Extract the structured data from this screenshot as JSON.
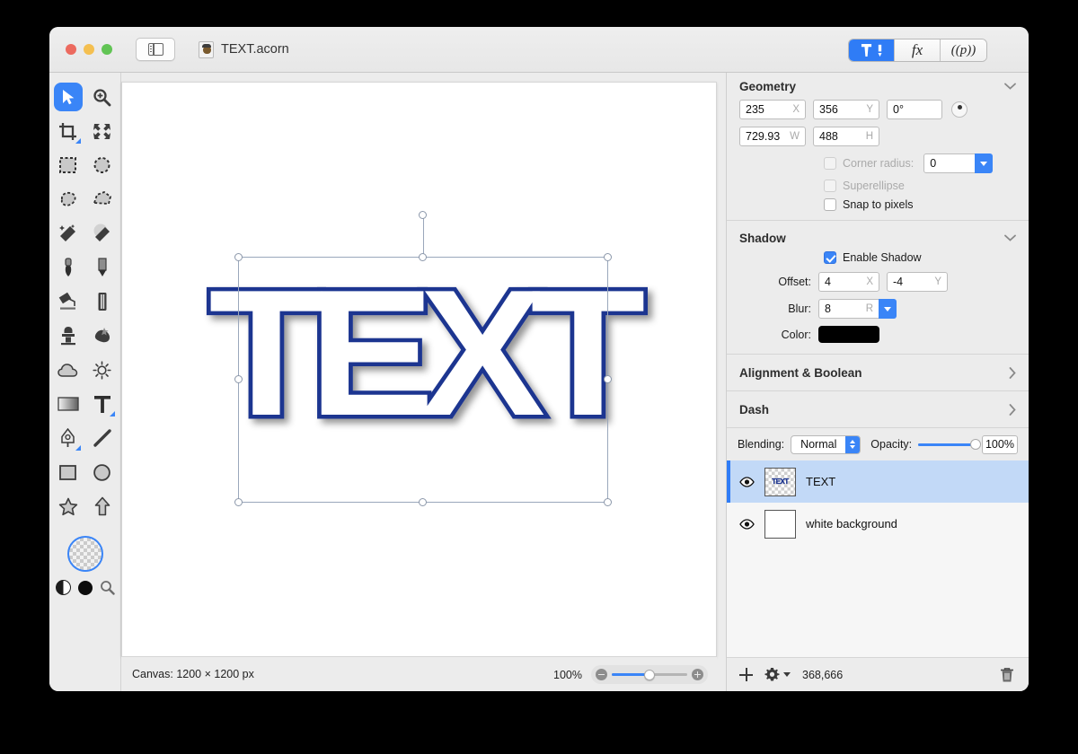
{
  "window": {
    "traffic_lights": [
      "close",
      "minimize",
      "zoom"
    ],
    "sidebar_toggle_icon": "sidebar-toggle-icon",
    "document_title": "TEXT.acorn",
    "document_icon": "acorn-document-icon"
  },
  "toolbar": {
    "segments": [
      {
        "id": "tools",
        "icon": "hammer-pen-icon",
        "label": "",
        "active": true
      },
      {
        "id": "effects",
        "label": "fx",
        "active": false
      },
      {
        "id": "presets",
        "label": "((p))",
        "active": false
      }
    ]
  },
  "tools": {
    "items": [
      {
        "name": "move-select-tool",
        "icon": "arrow-cursor-icon",
        "selected": true
      },
      {
        "name": "zoom-tool",
        "icon": "magnifier-plus-icon",
        "selected": false
      },
      {
        "name": "crop-tool",
        "icon": "crop-icon",
        "selected": false,
        "has_options": true
      },
      {
        "name": "transform-tool",
        "icon": "four-arrows-icon",
        "selected": false
      },
      {
        "name": "rectangle-select-tool",
        "icon": "dashed-rectangle-icon",
        "selected": false
      },
      {
        "name": "ellipse-select-tool",
        "icon": "dashed-circle-icon",
        "selected": false
      },
      {
        "name": "lasso-tool",
        "icon": "dashed-lasso-icon",
        "selected": false
      },
      {
        "name": "polygon-lasso-tool",
        "icon": "dashed-polygon-icon",
        "selected": false
      },
      {
        "name": "magic-wand-tool",
        "icon": "magic-wand-icon",
        "selected": false
      },
      {
        "name": "instant-alpha-tool",
        "icon": "dotted-wand-icon",
        "selected": false
      },
      {
        "name": "brush-tool",
        "icon": "brush-icon",
        "selected": false
      },
      {
        "name": "pencil-tool",
        "icon": "pencil-icon",
        "selected": false
      },
      {
        "name": "paint-bucket-tool",
        "icon": "paint-bucket-icon",
        "selected": false
      },
      {
        "name": "eraser-tool",
        "icon": "eraser-icon",
        "selected": false
      },
      {
        "name": "clone-stamp-tool",
        "icon": "clone-stamp-icon",
        "selected": false
      },
      {
        "name": "smudge-tool",
        "icon": "smudge-splat-icon",
        "selected": false
      },
      {
        "name": "blur-tool",
        "icon": "cloud-icon",
        "selected": false
      },
      {
        "name": "dodge-tool",
        "icon": "sun-icon",
        "selected": false
      },
      {
        "name": "gradient-tool",
        "icon": "gradient-icon",
        "selected": false
      },
      {
        "name": "text-tool",
        "icon": "text-t-icon",
        "selected": false,
        "has_options": true
      },
      {
        "name": "bezier-pen-tool",
        "icon": "pen-nib-icon",
        "selected": false,
        "has_options": true
      },
      {
        "name": "line-tool",
        "icon": "line-icon",
        "selected": false
      },
      {
        "name": "rectangle-shape-tool",
        "icon": "rectangle-icon",
        "selected": false
      },
      {
        "name": "ellipse-shape-tool",
        "icon": "circle-icon",
        "selected": false
      },
      {
        "name": "star-shape-tool",
        "icon": "star-icon",
        "selected": false
      },
      {
        "name": "arrow-shape-tool",
        "icon": "arrow-up-icon",
        "selected": false
      }
    ],
    "color_well": {
      "name": "color-well",
      "icon": "transparent-checker-icon"
    },
    "mini_controls": [
      {
        "name": "swap-colors-swatch",
        "icon": "half-black-half-white-circle-icon"
      },
      {
        "name": "foreground-color-swatch",
        "icon": "black-circle-icon",
        "color": "#000000"
      },
      {
        "name": "eyedropper-tool",
        "icon": "magnifier-icon"
      }
    ]
  },
  "canvas": {
    "artwork_text": "TEXT",
    "outline_color": "#1b3490",
    "fill_color": "#ffffff",
    "selection": {
      "handles": [
        "top-left",
        "top-center",
        "top-right",
        "middle-left",
        "middle-right",
        "bottom-left",
        "bottom-center",
        "bottom-right"
      ],
      "rotation_handle": "rotation-handle"
    }
  },
  "statusbar": {
    "canvas_info": "Canvas: 1200 × 1200 px",
    "zoom_level": "100%",
    "zoom_out_icon": "minus-circle-icon",
    "zoom_in_icon": "plus-circle-icon"
  },
  "inspector": {
    "geometry": {
      "title": "Geometry",
      "expanded": true,
      "chevron": "chevron-down-icon",
      "x": {
        "value": "235",
        "unit": "X"
      },
      "y": {
        "value": "356",
        "unit": "Y"
      },
      "rotation": {
        "value": "0°"
      },
      "w": {
        "value": "729.93",
        "unit": "W"
      },
      "h": {
        "value": "488",
        "unit": "H"
      },
      "corner_radius": {
        "label": "Corner radius:",
        "value": "0",
        "checked": false,
        "disabled": true
      },
      "superellipse": {
        "label": "Superellipse",
        "checked": false,
        "disabled": true
      },
      "snap_to_pixels": {
        "label": "Snap to pixels",
        "checked": false,
        "disabled": false
      }
    },
    "shadow": {
      "title": "Shadow",
      "expanded": true,
      "chevron": "chevron-down-icon",
      "enable": {
        "label": "Enable Shadow",
        "checked": true
      },
      "offset_label": "Offset:",
      "offset_x": {
        "value": "4",
        "unit": "X"
      },
      "offset_y": {
        "value": "-4",
        "unit": "Y"
      },
      "blur_label": "Blur:",
      "blur": {
        "value": "8",
        "unit": "R"
      },
      "color_label": "Color:",
      "color": "#000000"
    },
    "collapsed_sections": [
      {
        "title": "Alignment & Boolean",
        "chevron": "chevron-right-icon"
      },
      {
        "title": "Dash",
        "chevron": "chevron-right-icon"
      }
    ],
    "blending": {
      "label": "Blending:",
      "mode": "Normal",
      "opacity_label": "Opacity:",
      "opacity_value": "100%",
      "opacity_percent": 100
    },
    "layers": [
      {
        "name": "TEXT",
        "visible": true,
        "selected": true,
        "thumb_type": "transparent",
        "thumb_text": "TEXT"
      },
      {
        "name": "white background",
        "visible": true,
        "selected": false,
        "thumb_type": "white",
        "thumb_text": ""
      }
    ],
    "layer_bar": {
      "add_icon": "plus-icon",
      "settings_icon": "gear-icon",
      "settings_arrow": "chevron-down-icon",
      "memory": "368,666",
      "delete_icon": "trash-icon"
    }
  }
}
